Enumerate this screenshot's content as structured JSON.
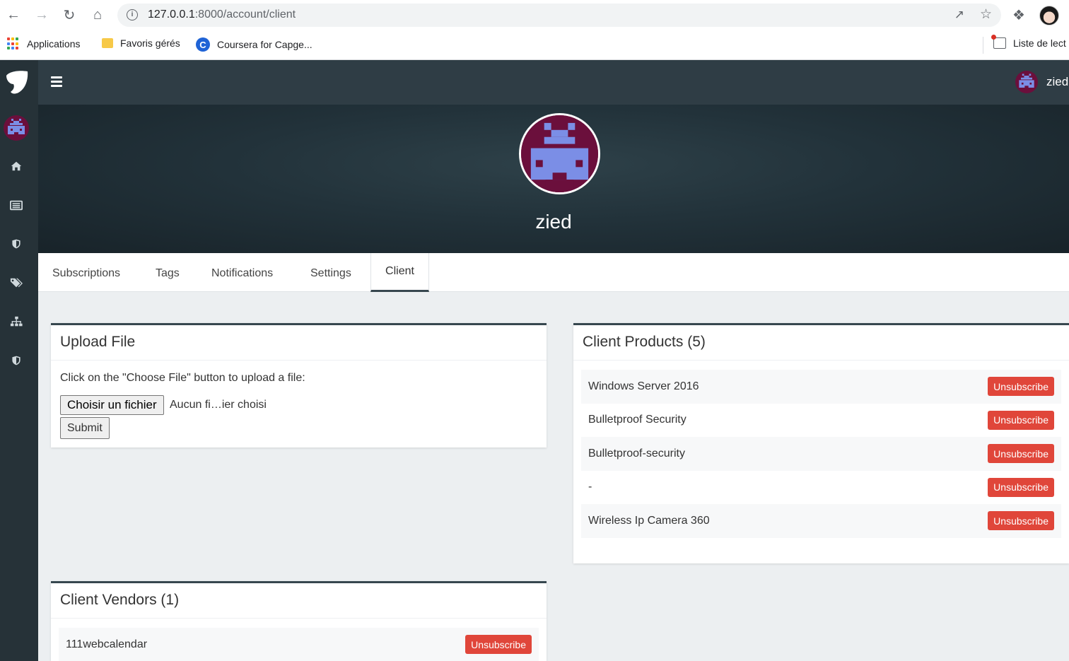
{
  "browser": {
    "url_host": "127.0.0.1",
    "url_rest": ":8000/account/client",
    "bookmarks": [
      {
        "label": "Applications"
      },
      {
        "label": "Favoris gérés"
      },
      {
        "label": "Coursera for Capge..."
      }
    ],
    "reading_list": "Liste de lect"
  },
  "topbar": {
    "username": "zied"
  },
  "sidebar": {
    "icons": [
      "home-icon",
      "list-icon",
      "shield-icon",
      "tags-icon",
      "sitemap-icon",
      "shield-icon"
    ]
  },
  "banner": {
    "username": "zied"
  },
  "tabs": [
    {
      "label": "Subscriptions"
    },
    {
      "label": "Tags"
    },
    {
      "label": "Notifications"
    },
    {
      "label": "Settings"
    },
    {
      "label": "Client",
      "active": true
    }
  ],
  "upload": {
    "title": "Upload File",
    "instruction": "Click on the \"Choose File\" button to upload a file:",
    "choose_label": "Choisir un fichier",
    "no_file": "Aucun fi…ier choisi",
    "submit_label": "Submit"
  },
  "products": {
    "title": "Client Products (5)",
    "items": [
      {
        "name": "Windows Server 2016",
        "action": "Unsubscribe"
      },
      {
        "name": "Bulletproof Security",
        "action": "Unsubscribe"
      },
      {
        "name": "Bulletproof-security",
        "action": "Unsubscribe"
      },
      {
        "name": "-",
        "action": "Unsubscribe"
      },
      {
        "name": "Wireless Ip Camera 360",
        "action": "Unsubscribe"
      }
    ]
  },
  "vendors": {
    "title": "Client Vendors (1)",
    "items": [
      {
        "name": "111webcalendar",
        "action": "Unsubscribe"
      }
    ]
  },
  "colors": {
    "sidebar": "#263238",
    "topbar": "#2f3d45",
    "avatar_bg": "#6b0f3c",
    "avatar_fg": "#7b8ee6",
    "danger": "#e0463a"
  }
}
